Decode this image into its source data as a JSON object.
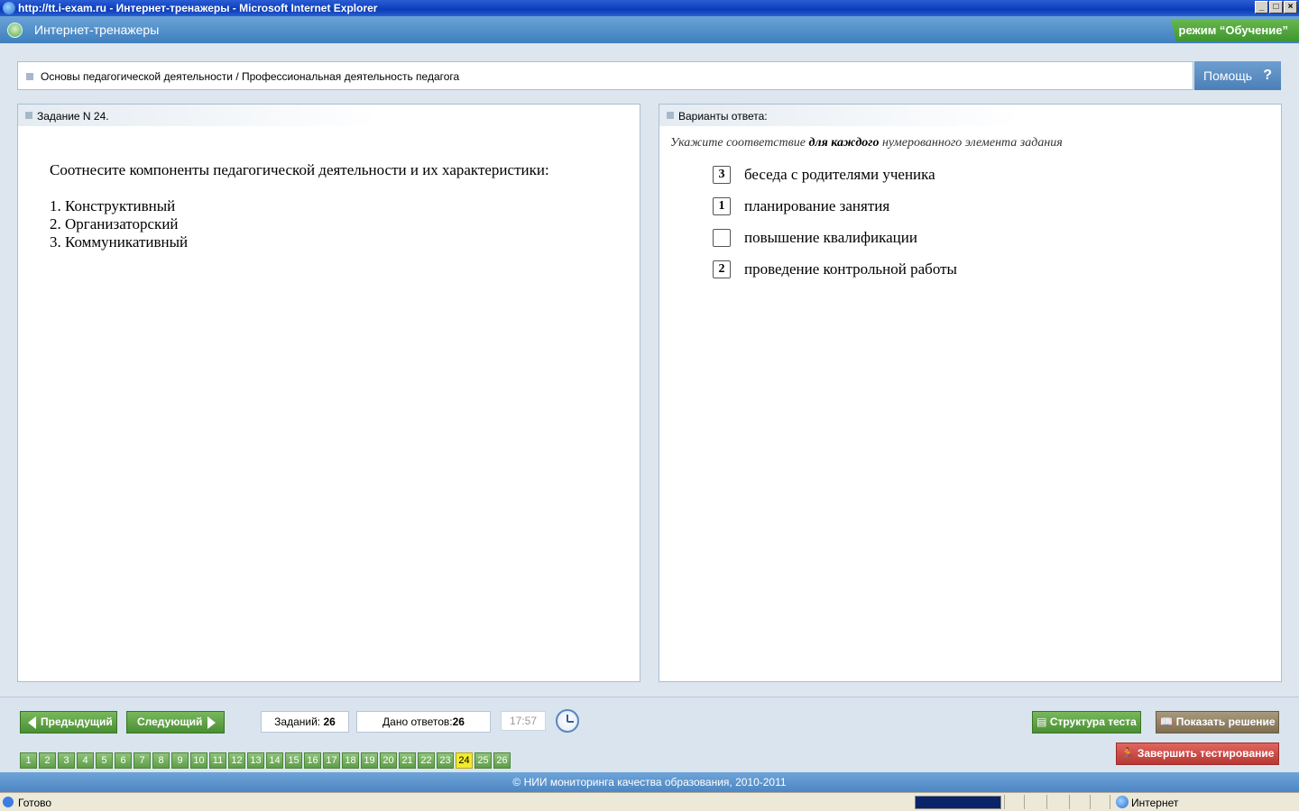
{
  "browser": {
    "title": "http://tt.i-exam.ru - Интернет-тренажеры - Microsoft Internet Explorer",
    "status_text": "Готово",
    "zone_text": "Интернет",
    "progress": 1.0
  },
  "app": {
    "title": "Интернет-тренажеры",
    "mode": "режим “Обучение”"
  },
  "breadcrumb": "Основы педагогической деятельности / Профессиональная деятельность педагога",
  "help_label": "Помощь",
  "help_icon": "?",
  "task_panel": {
    "header": "Задание N 24.",
    "question": "Соотнесите компоненты педагогической деятельности и их характеристики:",
    "items": [
      "1. Конструктивный",
      "2. Организаторский",
      "3. Коммуникативный"
    ]
  },
  "answer_panel": {
    "header": "Варианты ответа:",
    "instruction_pre": "Укажите соответствие ",
    "instruction_bold": "для каждого",
    "instruction_post": " нумерованного элемента задания",
    "options": [
      {
        "value": "3",
        "label": "беседа с родителями ученика"
      },
      {
        "value": "1",
        "label": "планирование занятия"
      },
      {
        "value": "",
        "label": "повышение квалификации"
      },
      {
        "value": "2",
        "label": "проведение контрольной работы"
      }
    ]
  },
  "nav": {
    "prev_label": "Предыдущий",
    "next_label": "Следующий",
    "tasks_label": "Заданий:",
    "tasks_count": "26",
    "answers_label": "Дано ответов:",
    "answers_count": "26",
    "timer": "17:57",
    "structure_label": "Структура теста",
    "solution_label": "Показать решение",
    "finish_label": "Завершить тестирование",
    "current_page": 24,
    "pages": [
      "1",
      "2",
      "3",
      "4",
      "5",
      "6",
      "7",
      "8",
      "9",
      "10",
      "11",
      "12",
      "13",
      "14",
      "15",
      "16",
      "17",
      "18",
      "19",
      "20",
      "21",
      "22",
      "23",
      "24",
      "25",
      "26"
    ]
  },
  "footer": "© НИИ мониторинга качества образования, 2010-2011",
  "colors": {
    "accent_blue": "#4b7fb7",
    "green": "#4a8f34",
    "current_page": "#f2ea2c",
    "finish_red": "#b73833"
  }
}
